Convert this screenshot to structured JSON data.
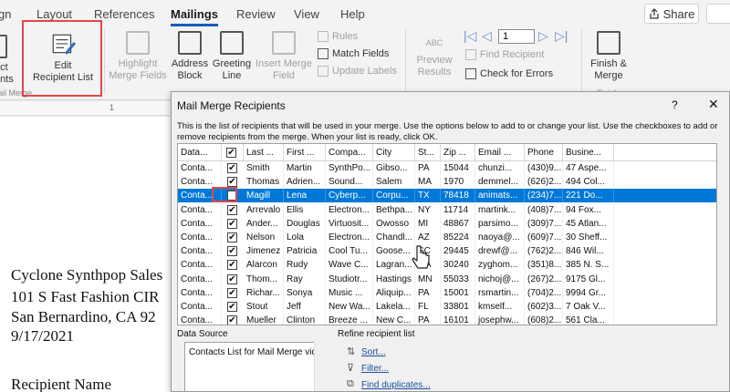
{
  "tabs": [
    "gn",
    "Layout",
    "References",
    "Mailings",
    "Review",
    "View",
    "Help"
  ],
  "share_label": "Share",
  "ribbon": {
    "start_btn": "ect\nents",
    "edit_recipient": [
      "Edit",
      "Recipient List"
    ],
    "highlight": [
      "Highlight",
      "Merge Fields"
    ],
    "address_block": [
      "Address",
      "Block"
    ],
    "greeting_line": [
      "Greeting",
      "Line"
    ],
    "insert_merge": [
      "Insert Merge",
      "Field"
    ],
    "rules": "Rules",
    "match_fields": "Match Fields",
    "update_labels": "Update Labels",
    "preview_abc": "ABC",
    "preview_results": [
      "Preview",
      "Results"
    ],
    "record_value": "1",
    "find_recipient": "Find Recipient",
    "check_errors": "Check for Errors",
    "finish": [
      "Finish &",
      "Merge"
    ],
    "group_mail_merge": "ail Merge",
    "group_finish": "Finish"
  },
  "ruler": {
    "mark": "1"
  },
  "document_lines": [
    "Cyclone Synthpop Sales",
    "101 S Fast Fashion CIR",
    "San Bernardino, CA 92",
    "9/17/2021",
    "Recipient Name"
  ],
  "dialog": {
    "title": "Mail Merge Recipients",
    "help": "?",
    "close": "✕",
    "description": "This is the list of recipients that will be used in your merge.  Use the options below to add to or change your list.  Use the checkboxes to add or remove recipients from the merge.  When your list is ready, click OK.",
    "columns": [
      "Data...",
      "",
      "Last ...",
      "First ...",
      "Compa...",
      "City",
      "St...",
      "Zip ...",
      "Email ...",
      "Phone",
      "Busine..."
    ],
    "rows": [
      {
        "source": "Conta...",
        "checked": true,
        "last": "Smith",
        "first": "Martin",
        "company": "SynthPo...",
        "city": "Gibso...",
        "state": "PA",
        "zip": "15044",
        "email": "chunzi...",
        "phone": "(430)9...",
        "business": "47 Aspe..."
      },
      {
        "source": "Conta...",
        "checked": true,
        "last": "Thomas",
        "first": "Adrien...",
        "company": "Sound...",
        "city": "Salem",
        "state": "MA",
        "zip": "1970",
        "email": "demmel...",
        "phone": "(626)2...",
        "business": "494 Col..."
      },
      {
        "source": "Conta...",
        "checked": false,
        "selected": true,
        "last": "Magill",
        "first": "Lena",
        "company": "Cyberp...",
        "city": "Corpu...",
        "state": "TX",
        "zip": "78418",
        "email": "animats...",
        "phone": "(234)7...",
        "business": "221 Do..."
      },
      {
        "source": "Conta...",
        "checked": true,
        "last": "Arrevalo",
        "first": "Ellis",
        "company": "Electron...",
        "city": "Bethpa...",
        "state": "NY",
        "zip": "11714",
        "email": "martink...",
        "phone": "(408)7...",
        "business": "94 Fox..."
      },
      {
        "source": "Conta...",
        "checked": true,
        "last": "Ander...",
        "first": "Douglas",
        "company": "Virtuosit...",
        "city": "Owosso",
        "state": "MI",
        "zip": "48867",
        "email": "parsimo...",
        "phone": "(309)7...",
        "business": "45 Atlan..."
      },
      {
        "source": "Conta...",
        "checked": true,
        "last": "Nelson",
        "first": "Lola",
        "company": "Electron...",
        "city": "Chandl...",
        "state": "AZ",
        "zip": "85224",
        "email": "naoya@...",
        "phone": "(609)7...",
        "business": "30 Sheff..."
      },
      {
        "source": "Conta...",
        "checked": true,
        "last": "Jimenez",
        "first": "Patricia",
        "company": "Cool Tu...",
        "city": "Goose...",
        "state": "SC",
        "zip": "29445",
        "email": "drewf@...",
        "phone": "(762)2...",
        "business": "846 Wil..."
      },
      {
        "source": "Conta...",
        "checked": true,
        "last": "Alarcon",
        "first": "Rudy",
        "company": "Wave C...",
        "city": "Lagran...",
        "state": "GA",
        "zip": "30240",
        "email": "zyghom...",
        "phone": "(351)8...",
        "business": "385 N. S..."
      },
      {
        "source": "Conta...",
        "checked": true,
        "last": "Thom...",
        "first": "Ray",
        "company": "Studiotr...",
        "city": "Hastings",
        "state": "MN",
        "zip": "55033",
        "email": "nichoj@...",
        "phone": "(267)2...",
        "business": "9175 Gl..."
      },
      {
        "source": "Conta...",
        "checked": true,
        "last": "Richar...",
        "first": "Sonya",
        "company": "Music ...",
        "city": "Aliquip...",
        "state": "PA",
        "zip": "15001",
        "email": "rsmartin...",
        "phone": "(704)2...",
        "business": "9994 Gr..."
      },
      {
        "source": "Conta...",
        "checked": true,
        "last": "Stout",
        "first": "Jeff",
        "company": "New Wa...",
        "city": "Lakela...",
        "state": "FL",
        "zip": "33801",
        "email": "kmself...",
        "phone": "(602)3...",
        "business": "7 Oak V..."
      },
      {
        "source": "Conta...",
        "checked": true,
        "last": "Mueller",
        "first": "Clinton",
        "company": "Breeze ...",
        "city": "New C...",
        "state": "PA",
        "zip": "16101",
        "email": "josephw...",
        "phone": "(608)2...",
        "business": "561 Cla..."
      }
    ],
    "data_source_label": "Data Source",
    "data_source_item": "Contacts List for Mail Merge vid",
    "refine_label": "Refine recipient list",
    "refine_links": [
      "Sort...",
      "Filter...",
      "Find duplicates..."
    ]
  },
  "icons": [
    "edit-recipient-list-icon",
    "highlight-icon",
    "address-block-icon",
    "greeting-line-icon",
    "insert-merge-field-icon",
    "rules-icon",
    "match-fields-icon",
    "update-labels-icon",
    "preview-results-icon",
    "first-record-icon",
    "prev-record-icon",
    "next-record-icon",
    "last-record-icon",
    "find-recipient-icon",
    "check-errors-icon",
    "finish-merge-icon",
    "sort-icon",
    "filter-icon",
    "find-duplicates-icon",
    "mouse-cursor-icon"
  ],
  "colors": {
    "accent": "#185abd",
    "selection": "#0078d7",
    "highlight_box": "#e04848",
    "link": "#1a4fa0"
  }
}
